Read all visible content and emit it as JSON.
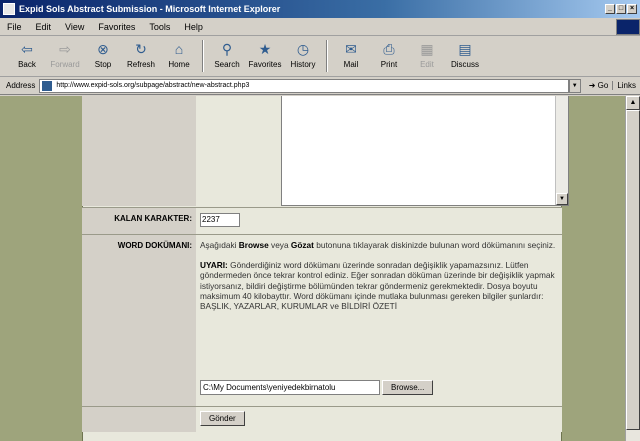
{
  "window": {
    "title": "Expid Sols Abstract Submission - Microsoft Internet Explorer"
  },
  "menu": {
    "items": [
      "File",
      "Edit",
      "View",
      "Favorites",
      "Tools",
      "Help"
    ]
  },
  "toolbar": {
    "buttons": [
      {
        "label": "Back",
        "icon": "back-arrow-icon"
      },
      {
        "label": "Forward",
        "icon": "forward-arrow-icon"
      },
      {
        "label": "Stop",
        "icon": "stop-icon"
      },
      {
        "label": "Refresh",
        "icon": "refresh-icon"
      },
      {
        "label": "Home",
        "icon": "home-icon"
      },
      {
        "label": "Search",
        "icon": "search-icon"
      },
      {
        "label": "Favorites",
        "icon": "favorites-icon"
      },
      {
        "label": "History",
        "icon": "history-icon"
      },
      {
        "label": "Mail",
        "icon": "mail-icon"
      },
      {
        "label": "Print",
        "icon": "print-icon"
      },
      {
        "label": "Edit",
        "icon": "edit-icon"
      },
      {
        "label": "Discuss",
        "icon": "discuss-icon"
      }
    ]
  },
  "address": {
    "label": "Address",
    "url": "http://www.expid-sols.org/subpage/abstract/new-abstract.php3",
    "go_label": "Go",
    "links_label": "Links"
  },
  "form": {
    "kalan_label": "KALAN KARAKTER:",
    "kalan_value": "2237",
    "word_label": "WORD DOKÜMANI:",
    "word_intro_1": "Aşağıdaki ",
    "word_intro_browse": "Browse",
    "word_intro_2": " veya ",
    "word_intro_gozat": "Gözat",
    "word_intro_3": " butonuna tıklayarak diskinizde bulunan word dökümanını seçiniz.",
    "uyari_label": "UYARI:",
    "uyari_text": " Gönderdiğiniz word dökümanı üzerinde sonradan değişiklik yapamazsınız. Lütfen göndermeden önce tekrar kontrol ediniz. Eğer sonradan döküman üzerinde bir değişiklik yapmak istiyorsanız, bildiri değiştirme bölümünden tekrar göndermeniz gerekmektedir. Dosya boyutu maksimum 40 kilobayttır. Word dökümanı içinde mutlaka bulunması gereken bilgiler şunlardır: BAŞLIK, YAZARLAR, KURUMLAR ve BİLDİRİ ÖZETİ",
    "file_value": "C:\\My Documents\\yeniyedekbirnatolu",
    "browse_label": "Browse...",
    "submit_label": "Gönder"
  }
}
